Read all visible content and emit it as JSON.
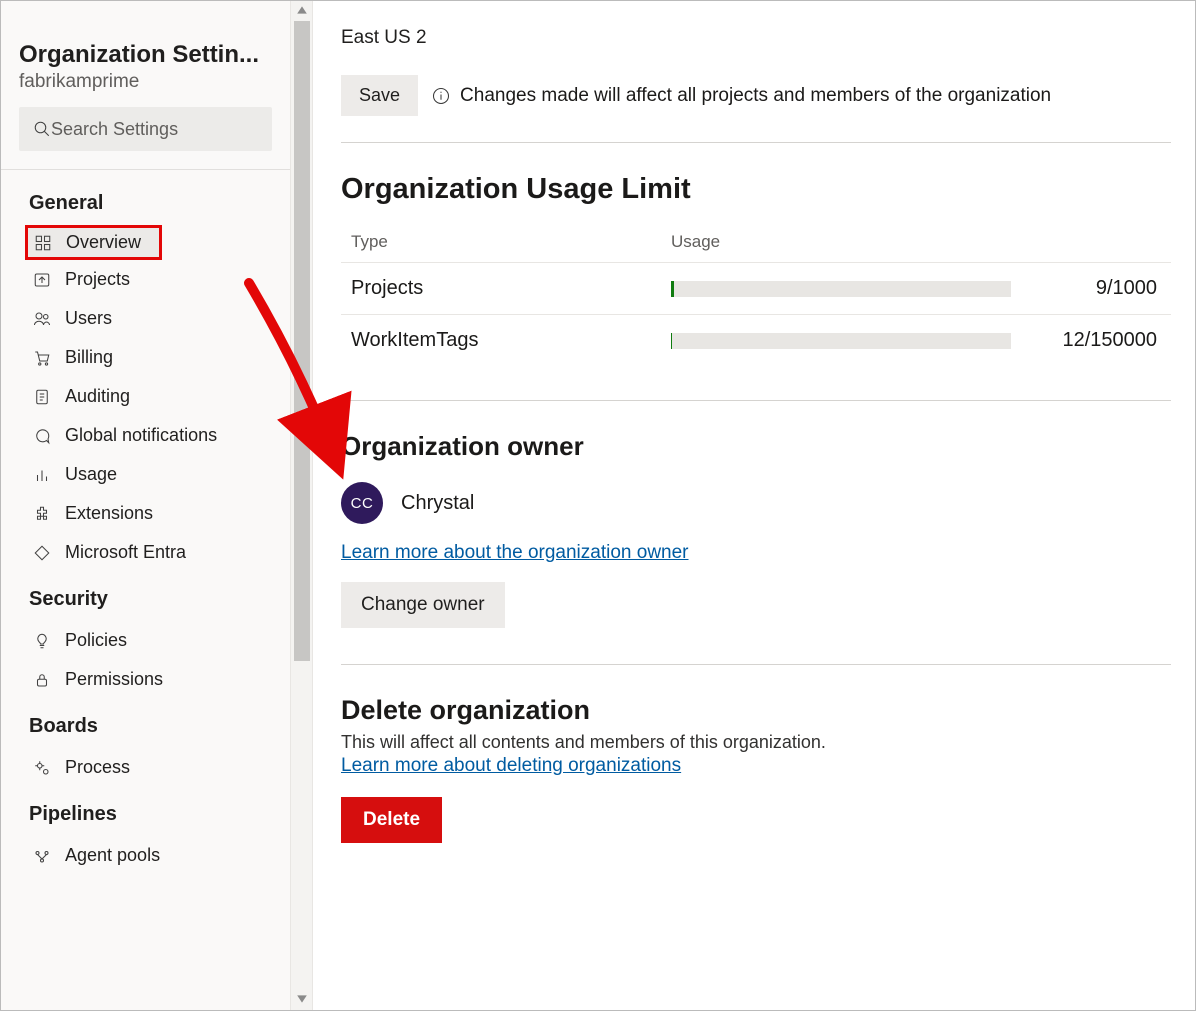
{
  "sidebar": {
    "title": "Organization Settin...",
    "subtitle": "fabrikamprime",
    "search_placeholder": "Search Settings",
    "groups": [
      {
        "label": "General",
        "items": [
          {
            "id": "overview",
            "label": "Overview",
            "icon": "grid-icon",
            "selected": true
          },
          {
            "id": "projects",
            "label": "Projects",
            "icon": "upload-box-icon"
          },
          {
            "id": "users",
            "label": "Users",
            "icon": "users-icon"
          },
          {
            "id": "billing",
            "label": "Billing",
            "icon": "cart-icon"
          },
          {
            "id": "auditing",
            "label": "Auditing",
            "icon": "document-icon"
          },
          {
            "id": "notifications",
            "label": "Global notifications",
            "icon": "chat-icon"
          },
          {
            "id": "usage",
            "label": "Usage",
            "icon": "bar-chart-icon"
          },
          {
            "id": "extensions",
            "label": "Extensions",
            "icon": "puzzle-icon"
          },
          {
            "id": "entra",
            "label": "Microsoft Entra",
            "icon": "diamond-icon"
          }
        ]
      },
      {
        "label": "Security",
        "items": [
          {
            "id": "policies",
            "label": "Policies",
            "icon": "bulb-icon"
          },
          {
            "id": "permissions",
            "label": "Permissions",
            "icon": "lock-icon"
          }
        ]
      },
      {
        "label": "Boards",
        "items": [
          {
            "id": "process",
            "label": "Process",
            "icon": "gears-icon"
          }
        ]
      },
      {
        "label": "Pipelines",
        "items": [
          {
            "id": "agentpools",
            "label": "Agent pools",
            "icon": "pool-icon"
          }
        ]
      }
    ]
  },
  "main": {
    "region": "East US 2",
    "save_label": "Save",
    "save_note": "Changes made will affect all projects and members of the organization",
    "usage": {
      "heading": "Organization Usage Limit",
      "col_type": "Type",
      "col_usage": "Usage",
      "rows": [
        {
          "type": "Projects",
          "value": 9,
          "limit": 1000,
          "display": "9/1000"
        },
        {
          "type": "WorkItemTags",
          "value": 12,
          "limit": 150000,
          "display": "12/150000"
        }
      ]
    },
    "owner": {
      "heading": "Organization owner",
      "initials": "CC",
      "name": "Chrystal",
      "learn_link": "Learn more about the organization owner",
      "change_label": "Change owner"
    },
    "delete": {
      "heading": "Delete organization",
      "text": "This will affect all contents and members of this organization.",
      "learn_link": "Learn more about deleting organizations",
      "button": "Delete"
    }
  },
  "annotation": {
    "arrow_color": "#e30707"
  }
}
